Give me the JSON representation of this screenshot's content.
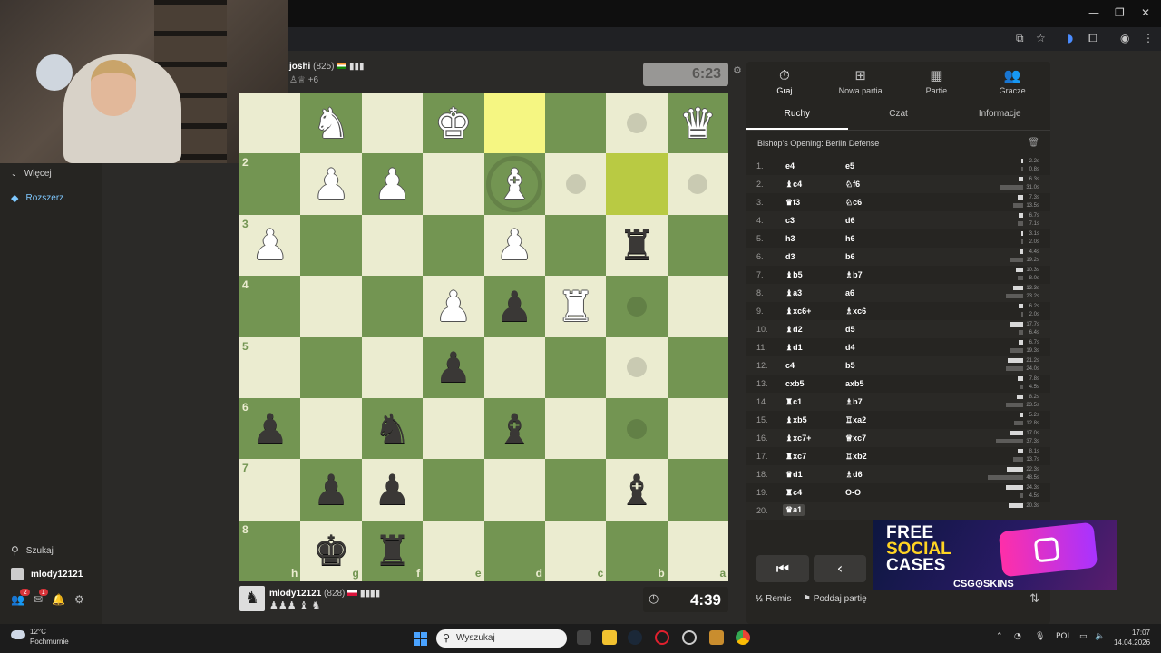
{
  "sidebar": {
    "more_label": "Więcej",
    "extend_label": "Rozszerz",
    "search_label": "Szukaj",
    "username": "mlody12121",
    "badge_friends": "2",
    "badge_messages": "1"
  },
  "top_player": {
    "name": "joshi",
    "rating": "(825)",
    "material": "+6",
    "clock": "6:23"
  },
  "bottom_player": {
    "name": "mlody12121",
    "rating": "(828)",
    "clock": "4:39"
  },
  "board": {
    "ranks": [
      "",
      "2",
      "3",
      "4",
      "5",
      "6",
      "7",
      "8"
    ],
    "files": [
      "h",
      "g",
      "f",
      "e",
      "d",
      "c",
      "b",
      "a"
    ],
    "rows": [
      [
        "",
        "wN",
        "",
        "wK",
        "",
        "",
        "",
        "wQ"
      ],
      [
        "",
        "wP",
        "wP",
        "",
        "wB",
        "",
        "",
        ""
      ],
      [
        "wP",
        "",
        "",
        "",
        "wP",
        "",
        "bR",
        ""
      ],
      [
        "",
        "",
        "",
        "wP",
        "bP",
        "wR",
        "",
        ""
      ],
      [
        "",
        "",
        "",
        "bP",
        "",
        "",
        "",
        ""
      ],
      [
        "bP",
        "",
        "bN",
        "",
        "bB",
        "",
        "",
        ""
      ],
      [
        "",
        "bP",
        "bP",
        "",
        "",
        "",
        "bB",
        ""
      ],
      [
        "",
        "bK",
        "bR",
        "",
        "",
        "",
        "",
        ""
      ]
    ]
  },
  "panel": {
    "main_tabs": [
      "Graj",
      "Nowa partia",
      "Partie",
      "Gracze"
    ],
    "sub_tabs": [
      "Ruchy",
      "Czat",
      "Informacje"
    ],
    "opening": "Bishop's Opening: Berlin Defense",
    "moves": [
      {
        "n": "1.",
        "w": "e4",
        "b": "e5",
        "tw": "2.2s",
        "tb": "0.8s"
      },
      {
        "n": "2.",
        "w": "♝c4",
        "b": "♘f6",
        "tw": "6.3s",
        "tb": "31.0s"
      },
      {
        "n": "3.",
        "w": "♛f3",
        "b": "♘c6",
        "tw": "7.3s",
        "tb": "13.5s"
      },
      {
        "n": "4.",
        "w": "c3",
        "b": "d6",
        "tw": "6.7s",
        "tb": "7.1s"
      },
      {
        "n": "5.",
        "w": "h3",
        "b": "h6",
        "tw": "3.1s",
        "tb": "2.0s"
      },
      {
        "n": "6.",
        "w": "d3",
        "b": "b6",
        "tw": "4.4s",
        "tb": "19.2s"
      },
      {
        "n": "7.",
        "w": "♝b5",
        "b": "♗b7",
        "tw": "10.3s",
        "tb": "8.0s"
      },
      {
        "n": "8.",
        "w": "♝a3",
        "b": "a6",
        "tw": "13.3s",
        "tb": "23.2s"
      },
      {
        "n": "9.",
        "w": "♝xc6+",
        "b": "♗xc6",
        "tw": "6.2s",
        "tb": "2.0s"
      },
      {
        "n": "10.",
        "w": "♝d2",
        "b": "d5",
        "tw": "17.7s",
        "tb": "6.4s"
      },
      {
        "n": "11.",
        "w": "♝d1",
        "b": "d4",
        "tw": "6.7s",
        "tb": "19.3s"
      },
      {
        "n": "12.",
        "w": "c4",
        "b": "b5",
        "tw": "21.2s",
        "tb": "24.0s"
      },
      {
        "n": "13.",
        "w": "cxb5",
        "b": "axb5",
        "tw": "7.8s",
        "tb": "4.5s"
      },
      {
        "n": "14.",
        "w": "♜c1",
        "b": "♗b7",
        "tw": "8.2s",
        "tb": "23.5s"
      },
      {
        "n": "15.",
        "w": "♝xb5",
        "b": "♖xa2",
        "tw": "5.2s",
        "tb": "12.8s"
      },
      {
        "n": "16.",
        "w": "♝xc7+",
        "b": "♕xc7",
        "tw": "17.0s",
        "tb": "37.3s"
      },
      {
        "n": "17.",
        "w": "♜xc7",
        "b": "♖xb2",
        "tw": "8.1s",
        "tb": "13.7s"
      },
      {
        "n": "18.",
        "w": "♛d1",
        "b": "♗d6",
        "tw": "22.3s",
        "tb": "48.5s"
      },
      {
        "n": "19.",
        "w": "♜c4",
        "b": "O-O",
        "tw": "24.3s",
        "tb": "4.5s"
      },
      {
        "n": "20.",
        "w": "♛a1",
        "b": "",
        "tw": "20.3s",
        "tb": ""
      }
    ],
    "draw_label": "Remis",
    "resign_label": "Poddaj partię"
  },
  "ad": {
    "line1": "FREE",
    "line2": "SOCIAL",
    "line3": "CASES",
    "brand": "CSG⊙SKINS"
  },
  "taskbar": {
    "temp": "12°C",
    "condition": "Pochmurnie",
    "search_placeholder": "Wyszukaj",
    "lang": "POL",
    "time": "17:07",
    "date": "14.04.2026"
  }
}
